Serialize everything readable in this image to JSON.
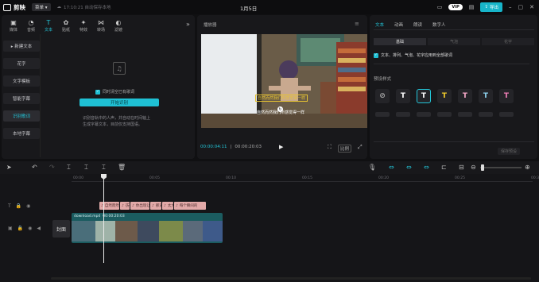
{
  "app": {
    "name": "剪映",
    "menu_label": "菜单",
    "autosave": "17:10:21 自动保存本地",
    "doc_title": "1月5日",
    "vip_label": "VIP",
    "export_label": "导出"
  },
  "media_tabs": [
    {
      "label": "媒体",
      "icon": "▣"
    },
    {
      "label": "音频",
      "icon": "◔"
    },
    {
      "label": "文本",
      "icon": "T"
    },
    {
      "label": "贴纸",
      "icon": "✿"
    },
    {
      "label": "特效",
      "icon": "✦"
    },
    {
      "label": "转场",
      "icon": "⋈"
    },
    {
      "label": "滤镜",
      "icon": "◐"
    }
  ],
  "text_sidebar": [
    {
      "label": "▸ 新建文本"
    },
    {
      "label": "花字"
    },
    {
      "label": "文字模板"
    },
    {
      "label": "智能字幕"
    },
    {
      "label": "识别歌词"
    },
    {
      "label": "本地字幕"
    }
  ],
  "lyrics": {
    "checkbox_label": "同时清空已有歌词",
    "button": "开始识别",
    "hint_line1": "识别音轨中的人声，并自动在时间轴上",
    "hint_line2": "生成字幕文本，目前仅支持国语。"
  },
  "player": {
    "header": "播放器",
    "caption1": "自然而然我们所感觉得一样",
    "caption2": "自然而然我们所感觉得一样",
    "current_time": "00:00:04:11",
    "duration": "00:00:20:03",
    "ratio_label": "比例"
  },
  "inspector": {
    "tabs": [
      "文本",
      "动画",
      "朗读",
      "数字人"
    ],
    "subtabs": [
      "基础",
      "气泡",
      "花字"
    ],
    "apply_all": "文本、排列、气泡、花字应用到全部歌词",
    "preset_title": "预设样式",
    "preset_colors": [
      "#ffffff",
      "#ffffff",
      "#f2cc2b",
      "#f6a9c8",
      "#8fd3f0",
      "#f27fb8"
    ],
    "save_preset": "保存预设"
  },
  "timeline": {
    "ruler": [
      "00:00",
      "00:05",
      "00:10",
      "00:15",
      "00:20",
      "00:25",
      "00:30"
    ],
    "text_clips": [
      "自然而然我们",
      "彷徨",
      "你出现让",
      "那道",
      "太大",
      "每个瞬间的"
    ],
    "cover_label": "封面",
    "video_clip_name": "download.mp4",
    "video_clip_duration": "00:00:20:03"
  }
}
